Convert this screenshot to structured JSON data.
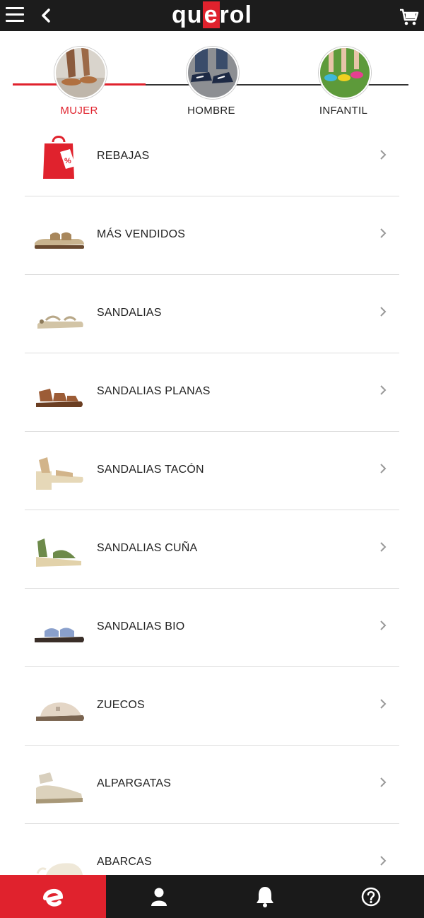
{
  "brand": {
    "logo_text_pre": "qu",
    "logo_text_e": "e",
    "logo_text_post": "rol",
    "accent": "#e0222d"
  },
  "categories": [
    {
      "label": "MUJER",
      "active": true
    },
    {
      "label": "HOMBRE",
      "active": false
    },
    {
      "label": "INFANTIL",
      "active": false
    }
  ],
  "menu": [
    {
      "label": "REBAJAS",
      "icon": "sale-bag-icon"
    },
    {
      "label": "MÁS VENDIDOS",
      "icon": "bio-sandal-icon"
    },
    {
      "label": "SANDALIAS",
      "icon": "sandal-icon"
    },
    {
      "label": "SANDALIAS PLANAS",
      "icon": "flat-sandal-icon"
    },
    {
      "label": "SANDALIAS TACÓN",
      "icon": "heel-sandal-icon"
    },
    {
      "label": "SANDALIAS CUÑA",
      "icon": "wedge-sandal-icon"
    },
    {
      "label": "SANDALIAS BIO",
      "icon": "bio-sandal-icon"
    },
    {
      "label": "ZUECOS",
      "icon": "clog-icon"
    },
    {
      "label": "ALPARGATAS",
      "icon": "espadrille-icon"
    },
    {
      "label": "ABARCAS",
      "icon": "abarca-icon"
    }
  ],
  "bottom_nav": [
    "home-icon",
    "user-icon",
    "bell-icon",
    "help-icon"
  ]
}
